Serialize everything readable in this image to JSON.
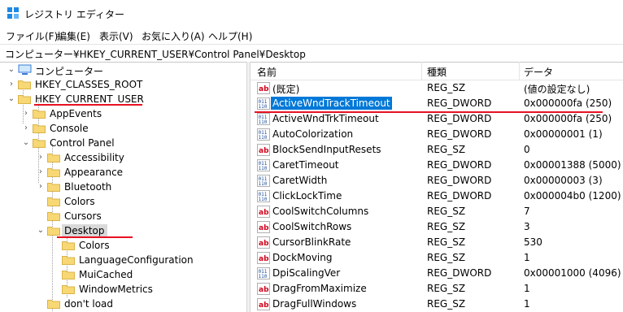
{
  "window": {
    "title": "レジストリ エディター"
  },
  "menu": [
    "ファイル(F)",
    "編集(E)",
    "表示(V)",
    "お気に入り(A)",
    "ヘルプ(H)"
  ],
  "address": "コンピューター¥HKEY_CURRENT_USER¥Control Panel¥Desktop",
  "tree": {
    "root": "コンピューター",
    "nodes": [
      {
        "label": "HKEY_CLASSES_ROOT",
        "level": 1,
        "expander": ">"
      },
      {
        "label": "HKEY_CURRENT_USER",
        "level": 1,
        "expander": "v"
      },
      {
        "label": "AppEvents",
        "level": 2,
        "expander": ">"
      },
      {
        "label": "Console",
        "level": 2,
        "expander": ">"
      },
      {
        "label": "Control Panel",
        "level": 2,
        "expander": "v"
      },
      {
        "label": "Accessibility",
        "level": 3,
        "expander": ">"
      },
      {
        "label": "Appearance",
        "level": 3,
        "expander": ">"
      },
      {
        "label": "Bluetooth",
        "level": 3,
        "expander": ">"
      },
      {
        "label": "Colors",
        "level": 3,
        "expander": ""
      },
      {
        "label": "Cursors",
        "level": 3,
        "expander": ""
      },
      {
        "label": "Desktop",
        "level": 3,
        "expander": "v"
      },
      {
        "label": "Colors",
        "level": 4,
        "expander": ""
      },
      {
        "label": "LanguageConfiguration",
        "level": 4,
        "expander": ""
      },
      {
        "label": "MuiCached",
        "level": 4,
        "expander": ""
      },
      {
        "label": "WindowMetrics",
        "level": 4,
        "expander": ""
      },
      {
        "label": "don't load",
        "level": 3,
        "expander": ""
      }
    ]
  },
  "columns": {
    "name": "名前",
    "type": "種類",
    "data": "データ"
  },
  "values": [
    {
      "name": "(既定)",
      "type": "REG_SZ",
      "data": "(値の設定なし)",
      "kind": "sz"
    },
    {
      "name": "ActiveWndTrackTimeout",
      "type": "REG_DWORD",
      "data": "0x000000fa (250)",
      "kind": "bin"
    },
    {
      "name": "ActiveWndTrkTimeout",
      "type": "REG_DWORD",
      "data": "0x000000fa (250)",
      "kind": "bin"
    },
    {
      "name": "AutoColorization",
      "type": "REG_DWORD",
      "data": "0x00000001 (1)",
      "kind": "bin"
    },
    {
      "name": "BlockSendInputResets",
      "type": "REG_SZ",
      "data": "0",
      "kind": "sz"
    },
    {
      "name": "CaretTimeout",
      "type": "REG_DWORD",
      "data": "0x00001388 (5000)",
      "kind": "bin"
    },
    {
      "name": "CaretWidth",
      "type": "REG_DWORD",
      "data": "0x00000003 (3)",
      "kind": "bin"
    },
    {
      "name": "ClickLockTime",
      "type": "REG_DWORD",
      "data": "0x000004b0 (1200)",
      "kind": "bin"
    },
    {
      "name": "CoolSwitchColumns",
      "type": "REG_SZ",
      "data": "7",
      "kind": "sz"
    },
    {
      "name": "CoolSwitchRows",
      "type": "REG_SZ",
      "data": "3",
      "kind": "sz"
    },
    {
      "name": "CursorBlinkRate",
      "type": "REG_SZ",
      "data": "530",
      "kind": "sz"
    },
    {
      "name": "DockMoving",
      "type": "REG_SZ",
      "data": "1",
      "kind": "sz"
    },
    {
      "name": "DpiScalingVer",
      "type": "REG_DWORD",
      "data": "0x00001000 (4096)",
      "kind": "bin"
    },
    {
      "name": "DragFromMaximize",
      "type": "REG_SZ",
      "data": "1",
      "kind": "sz"
    },
    {
      "name": "DragFullWindows",
      "type": "REG_SZ",
      "data": "1",
      "kind": "sz"
    }
  ],
  "colors": {
    "selection": "#0078d7",
    "annotation": "#e81123",
    "folder": "#f8d775"
  }
}
